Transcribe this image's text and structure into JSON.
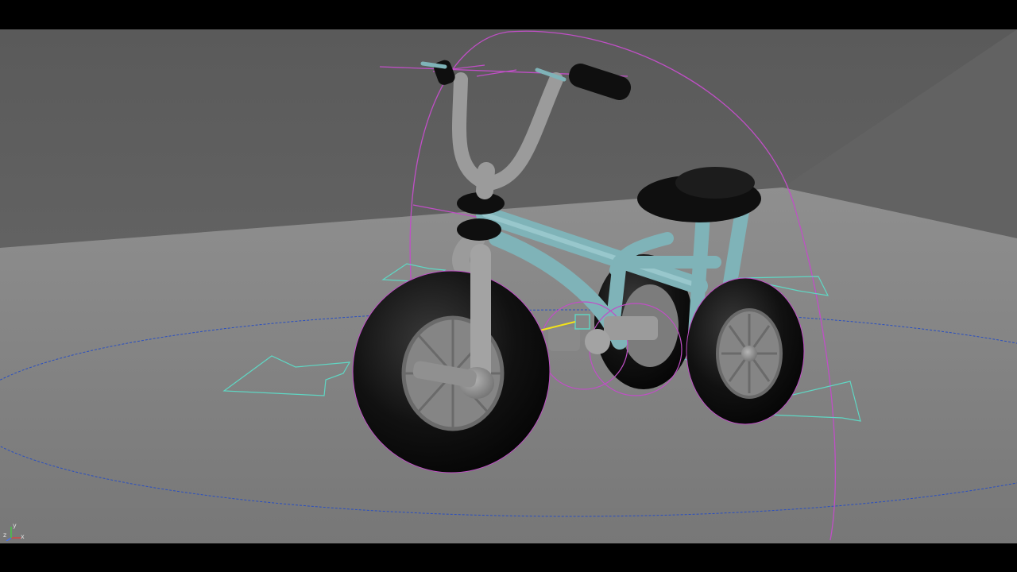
{
  "app": {
    "view": "perspective-viewport",
    "subject": "tricycle-rig"
  },
  "colors": {
    "background_wall": "#5c5c5c",
    "floor": "#8a8a8a",
    "frame": "#7fb3b8",
    "tire": "#0f0f0f",
    "metal": "#9b9b9b",
    "rig_magenta": "#c04fc6",
    "rig_cyan": "#5fd7c4",
    "rig_blue": "#2a4fc0",
    "arrow_yellow": "#f2e21a"
  },
  "axis_gizmo": {
    "x_label": "x",
    "y_label": "y",
    "z_label": "z"
  }
}
